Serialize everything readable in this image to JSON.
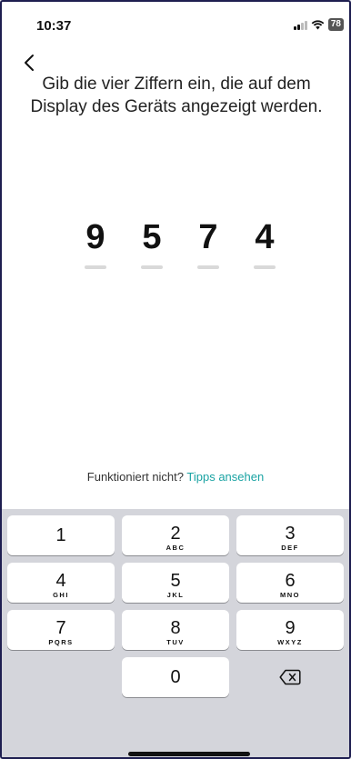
{
  "status_bar": {
    "time": "10:37",
    "battery": "78"
  },
  "instruction": "Gib die vier Ziffern ein, die auf dem Display des Geräts angezeigt werden.",
  "code_digits": [
    "9",
    "5",
    "7",
    "4"
  ],
  "help": {
    "question": "Funktioniert nicht?",
    "link": "Tipps ansehen"
  },
  "keypad": {
    "k1": {
      "num": "1",
      "letters": ""
    },
    "k2": {
      "num": "2",
      "letters": "ABC"
    },
    "k3": {
      "num": "3",
      "letters": "DEF"
    },
    "k4": {
      "num": "4",
      "letters": "GHI"
    },
    "k5": {
      "num": "5",
      "letters": "JKL"
    },
    "k6": {
      "num": "6",
      "letters": "MNO"
    },
    "k7": {
      "num": "7",
      "letters": "PQRS"
    },
    "k8": {
      "num": "8",
      "letters": "TUV"
    },
    "k9": {
      "num": "9",
      "letters": "WXYZ"
    },
    "k0": {
      "num": "0",
      "letters": ""
    }
  },
  "colors": {
    "link": "#1aa3a3",
    "keypad_bg": "#d4d5db",
    "frame": "#1e1e50"
  }
}
